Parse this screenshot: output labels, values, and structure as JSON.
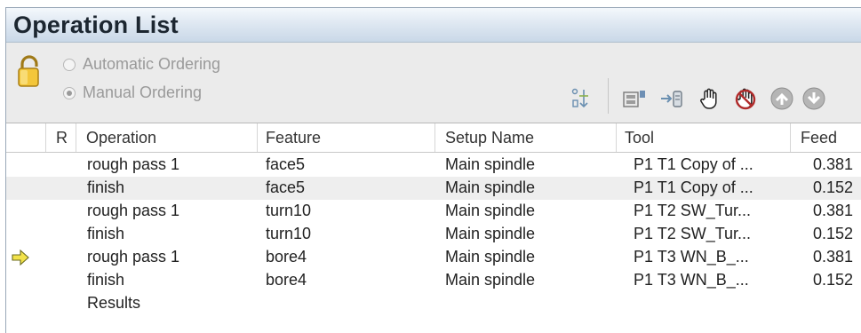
{
  "panel": {
    "title": "Operation List"
  },
  "toolbar": {
    "ordering": {
      "automatic_label": "Automatic Ordering",
      "manual_label": "Manual Ordering",
      "selected": "manual"
    },
    "icons": [
      "sort-icon",
      "post-icon",
      "move-to-icon",
      "hand-icon",
      "no-hand-icon",
      "move-up-icon",
      "move-down-icon"
    ]
  },
  "columns": {
    "r": "R",
    "operation": "Operation",
    "feature": "Feature",
    "setup": "Setup Name",
    "tool": "Tool",
    "feed": "Feed"
  },
  "rows": [
    {
      "operation": "rough pass 1",
      "feature": "face5",
      "setup": "Main spindle",
      "tool": "P1 T1 Copy of ...",
      "feed": "0.381",
      "current": false
    },
    {
      "operation": "finish",
      "feature": "face5",
      "setup": "Main spindle",
      "tool": "P1 T1 Copy of ...",
      "feed": "0.152",
      "current": false
    },
    {
      "operation": "rough pass 1",
      "feature": "turn10",
      "setup": "Main spindle",
      "tool": "P1 T2 SW_Tur...",
      "feed": "0.381",
      "current": false
    },
    {
      "operation": "finish",
      "feature": "turn10",
      "setup": "Main spindle",
      "tool": "P1 T2 SW_Tur...",
      "feed": "0.152",
      "current": false
    },
    {
      "operation": "rough pass 1",
      "feature": "bore4",
      "setup": "Main spindle",
      "tool": "P1 T3 WN_B_...",
      "feed": "0.381",
      "current": true
    },
    {
      "operation": "finish",
      "feature": "bore4",
      "setup": "Main spindle",
      "tool": "P1 T3 WN_B_...",
      "feed": "0.152",
      "current": false
    },
    {
      "operation": "Results",
      "feature": "",
      "setup": "",
      "tool": "",
      "feed": "",
      "current": false
    }
  ],
  "colors": {
    "accent_arrow": "#f2e24a",
    "title_bar": "#dfe8f2",
    "alt_row": "#eeeeee"
  }
}
